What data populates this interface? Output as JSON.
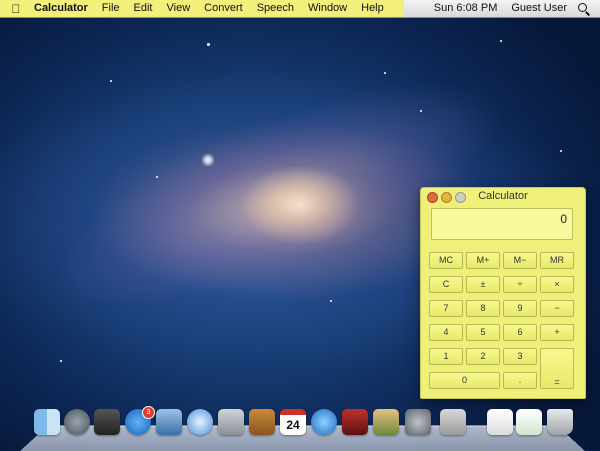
{
  "menubar": {
    "app_name": "Calculator",
    "items": [
      "File",
      "Edit",
      "View",
      "Convert",
      "Speech",
      "Window",
      "Help"
    ],
    "clock": "Sun 6:08 PM",
    "user": "Guest User"
  },
  "calculator": {
    "title": "Calculator",
    "display": "0",
    "keys": {
      "mc": "MC",
      "mplus": "M+",
      "mminus": "M−",
      "mr": "MR",
      "clear": "C",
      "plusminus": "±",
      "divide": "÷",
      "multiply": "×",
      "seven": "7",
      "eight": "8",
      "nine": "9",
      "minus": "−",
      "four": "4",
      "five": "5",
      "six": "6",
      "plus": "+",
      "one": "1",
      "two": "2",
      "three": "3",
      "zero": "0",
      "decimal": ".",
      "equals": "="
    }
  },
  "dock": {
    "icons": [
      "finder-icon",
      "launchpad-icon",
      "mission-control-icon",
      "app-store-icon",
      "mail-icon",
      "safari-icon",
      "facetime-icon",
      "contacts-icon",
      "calendar-icon",
      "itunes-icon",
      "photo-booth-icon",
      "iphoto-icon",
      "system-preferences-icon",
      "calculator-icon",
      "document-icon",
      "downloads-icon",
      "trash-icon"
    ],
    "calendar_day": "24",
    "app_store_badge": "3"
  },
  "colors": {
    "highlight": "#f2f07a",
    "calculator_body": "#eef07a"
  }
}
